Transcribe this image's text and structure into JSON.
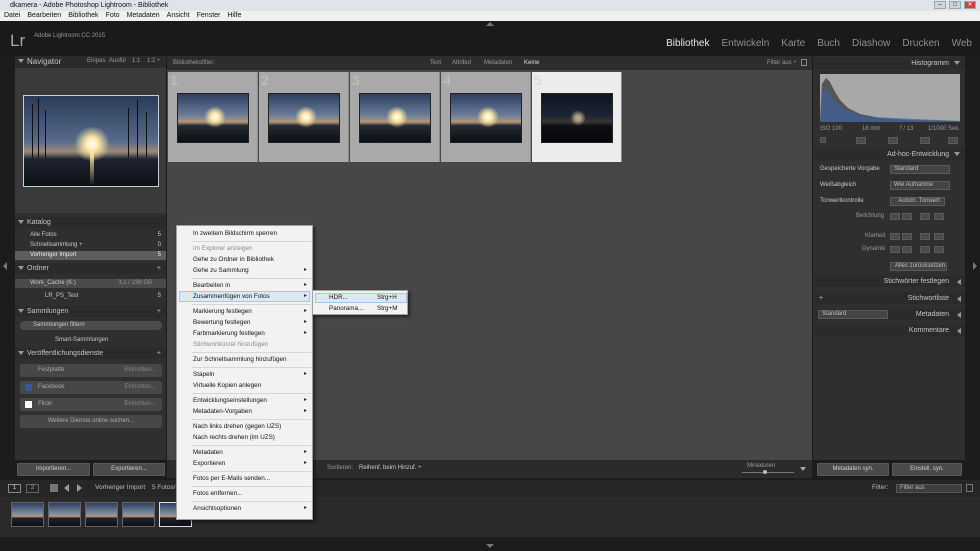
{
  "window": {
    "title": "dkamera - Adobe Photoshop Lightroom - Bibliothek",
    "min": "–",
    "max": "□",
    "close": "✕"
  },
  "menubar": [
    "Datei",
    "Bearbeiten",
    "Bibliothek",
    "Foto",
    "Metadaten",
    "Ansicht",
    "Fenster",
    "Hilfe"
  ],
  "app": {
    "logo": "Lr",
    "name": "Adobe Lightroom CC 2015"
  },
  "modules": [
    {
      "label": "Bibliothek",
      "active": true
    },
    {
      "label": "Entwickeln",
      "active": false
    },
    {
      "label": "Karte",
      "active": false
    },
    {
      "label": "Buch",
      "active": false
    },
    {
      "label": "Diashow",
      "active": false
    },
    {
      "label": "Drucken",
      "active": false
    },
    {
      "label": "Web",
      "active": false
    }
  ],
  "navigator": {
    "title": "Navigator",
    "opt1": "Einpas",
    "opt2": "Ausfül",
    "opt3": "1:1",
    "opt4": "1:2 ÷"
  },
  "catalog": {
    "title": "Katalog",
    "items": [
      {
        "label": "Alle Fotos",
        "count": "5"
      },
      {
        "label": "Schnellsammlung +",
        "count": "0"
      },
      {
        "label": "Vorheriger Import",
        "count": "5"
      }
    ]
  },
  "folders": {
    "title": "Ordner",
    "volume": "Work_Cache (K:)",
    "volume_info": "3,1 / 238 GB",
    "folder": "LR_PS_Test",
    "folder_count": "5"
  },
  "collections": {
    "title": "Sammlungen",
    "filter": "Sammlungen filtern",
    "smart": "Smart-Sammlungen"
  },
  "publish": {
    "title": "Veröffentlichungsdienste",
    "services": [
      {
        "label": "Festplatte",
        "action": "Einrichten..."
      },
      {
        "label": "Facebook",
        "action": "Einrichten..."
      },
      {
        "label": "Flickr",
        "action": "Einrichten..."
      }
    ],
    "more": "Weitere Dienste online suchen..."
  },
  "left_buttons": {
    "import": "Importieren...",
    "export": "Exportieren..."
  },
  "filterbar": {
    "label": "Bibliotheksfilter:",
    "text": "Text",
    "attribut": "Attribut",
    "metadaten": "Metadaten",
    "keine": "Keine",
    "filter_off": "Filter aus ÷"
  },
  "grid": {
    "cells": [
      {
        "num": "1",
        "selected": false
      },
      {
        "num": "2",
        "selected": false
      },
      {
        "num": "3",
        "selected": false
      },
      {
        "num": "4",
        "selected": false
      },
      {
        "num": "5",
        "selected": true
      }
    ]
  },
  "toolbar": {
    "sort_label": "Sortieren:",
    "sort_value": "Reihenf. beim Hinzuf. ÷",
    "thumbs": "Miniaturen"
  },
  "histogram": {
    "title": "Histogramm",
    "iso": "ISO 100",
    "focal": "18 mm",
    "aperture": "f / 13",
    "shutter": "1/1000 Sek."
  },
  "quick_develop": {
    "title": "Ad-hoc-Entwicklung",
    "preset_label": "Gespeicherte Vorgabe",
    "preset_value": "Standard",
    "wb_label": "Weißabgleich",
    "wb_value": "Wie Aufnahme",
    "tone_label": "Tonwertkontrolle",
    "auto_tone": "Autom. Tonwert",
    "exposure": "Belichtung",
    "clarity": "Klarheit",
    "vibrance": "Dynamik",
    "reset": "Alles zurücksetzen"
  },
  "right_sections": {
    "keywording": "Stichwörter festlegen",
    "keyword_list": "Stichwortliste",
    "metadata": "Metadaten",
    "metadata_value": "Standard",
    "comments": "Kommentare",
    "plus": "+"
  },
  "right_buttons": {
    "sync_meta": "Metadaten syn.",
    "sync_settings": "Einstell. syn."
  },
  "filmstrip_bar": {
    "page1": "1",
    "page2": "2",
    "source": "Vorheriger Import",
    "count": "5 Fotos/",
    "filter_label": "Filter:",
    "filter_value": "Filter aus"
  },
  "context_menu": [
    {
      "label": "In zweitem Bildschirm sperren",
      "arrow": false,
      "disabled": false,
      "sep_after": true
    },
    {
      "label": "Im Explorer anzeigen",
      "arrow": false,
      "disabled": true,
      "sep_after": false
    },
    {
      "label": "Gehe zu Ordner in Bibliothek",
      "arrow": false,
      "disabled": false,
      "sep_after": false
    },
    {
      "label": "Gehe zu Sammlung",
      "arrow": true,
      "disabled": false,
      "sep_after": true
    },
    {
      "label": "Bearbeiten in",
      "arrow": true,
      "disabled": false,
      "sep_after": false
    },
    {
      "label": "Zusammenfügen von Fotos",
      "arrow": true,
      "disabled": false,
      "sep_after": true
    },
    {
      "label": "Markierung festlegen",
      "arrow": true,
      "disabled": false,
      "sep_after": false
    },
    {
      "label": "Bewertung festlegen",
      "arrow": true,
      "disabled": false,
      "sep_after": false
    },
    {
      "label": "Farbmarkierung festlegen",
      "arrow": true,
      "disabled": false,
      "sep_after": false
    },
    {
      "label": "Stichwortkürzel hinzufügen",
      "arrow": false,
      "disabled": true,
      "sep_after": true
    },
    {
      "label": "Zur Schnellsammlung hinzufügen",
      "arrow": false,
      "disabled": false,
      "sep_after": true
    },
    {
      "label": "Stapeln",
      "arrow": true,
      "disabled": false,
      "sep_after": false
    },
    {
      "label": "Virtuelle Kopien anlegen",
      "arrow": false,
      "disabled": false,
      "sep_after": true
    },
    {
      "label": "Entwicklungseinstellungen",
      "arrow": true,
      "disabled": false,
      "sep_after": false
    },
    {
      "label": "Metadaten-Vorgaben",
      "arrow": true,
      "disabled": false,
      "sep_after": true
    },
    {
      "label": "Nach links drehen (gegen UZS)",
      "arrow": false,
      "disabled": false,
      "sep_after": false
    },
    {
      "label": "Nach rechts drehen (im UZS)",
      "arrow": false,
      "disabled": false,
      "sep_after": true
    },
    {
      "label": "Metadaten",
      "arrow": true,
      "disabled": false,
      "sep_after": false
    },
    {
      "label": "Exportieren",
      "arrow": true,
      "disabled": false,
      "sep_after": true
    },
    {
      "label": "Fotos per E-Mails senden...",
      "arrow": false,
      "disabled": false,
      "sep_after": true
    },
    {
      "label": "Fotos entfernen...",
      "arrow": false,
      "disabled": false,
      "sep_after": true
    },
    {
      "label": "Ansichtsoptionen",
      "arrow": true,
      "disabled": false,
      "sep_after": false
    }
  ],
  "submenu": [
    {
      "label": "HDR...",
      "shortcut": "Strg+H"
    },
    {
      "label": "Panorama...",
      "shortcut": "Strg+M"
    }
  ],
  "icons": {
    "submenu_arrow": "▸",
    "panel_collapse": "◂",
    "panel_expand": "▾"
  }
}
